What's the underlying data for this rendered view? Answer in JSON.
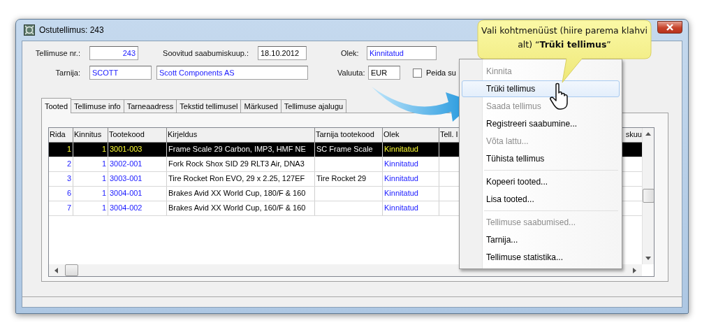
{
  "window": {
    "title": "Ostutellimus: 243"
  },
  "form": {
    "rows": [
      {
        "fields": [
          {
            "label": "Tellimuse nr.:",
            "values": [
              {
                "value": "243",
                "linked": true
              }
            ]
          },
          {
            "label": "Soovitud saabumiskuup.:",
            "values": [
              {
                "value": "18.10.2012",
                "linked": false
              }
            ]
          },
          {
            "label": "Olek:",
            "values": [
              {
                "value": "Kinnitatud",
                "linked": true
              }
            ]
          }
        ]
      },
      {
        "fields": [
          {
            "label": "Tarnija:",
            "values": [
              {
                "value": "SCOTT",
                "linked": true
              },
              {
                "value": "Scott Components AS",
                "linked": true
              }
            ]
          },
          {
            "label": "Valuuta:",
            "values": [
              {
                "value": "EUR",
                "linked": false
              }
            ]
          }
        ]
      }
    ]
  },
  "hide_option": {
    "label": "Peida su",
    "checked": false
  },
  "tabs": [
    {
      "label": "Tooted",
      "selected": true
    },
    {
      "label": "Tellimuse info",
      "selected": false
    },
    {
      "label": "Tarneaadress",
      "selected": false
    },
    {
      "label": "Tekstid tellimusel",
      "selected": false
    },
    {
      "label": "Märkused",
      "selected": false
    },
    {
      "label": "Tellimuse ajalugu",
      "selected": false
    }
  ],
  "table": {
    "columns": [
      {
        "title": "Rida",
        "kind": "number"
      },
      {
        "title": "Kinnitus",
        "kind": "number"
      },
      {
        "title": "Tootekood",
        "kind": "code"
      },
      {
        "title": "Kirjeldus",
        "kind": "text"
      },
      {
        "title": "Tarnija tootekood",
        "kind": "text"
      },
      {
        "title": "Olek",
        "kind": "code"
      },
      {
        "title": "Tell. I",
        "kind": "text"
      },
      {
        "title": "skuu",
        "kind": "text"
      }
    ],
    "rows": [
      {
        "selected": true,
        "cells": [
          "1",
          "1",
          "3001-003",
          "Frame Scale 29 Carbon, IMP3, HMF NE",
          "SC Frame Scale",
          "Kinnitatud",
          null,
          null
        ]
      },
      {
        "selected": false,
        "cells": [
          "2",
          "1",
          "3002-001",
          "Fork Rock Shox SID 29 RLT3 Air, DNA3",
          null,
          "Kinnitatud",
          null,
          null
        ]
      },
      {
        "selected": false,
        "cells": [
          "3",
          "1",
          "3003-001",
          "Tire Rocket Ron EVO, 29 x 2.25, 127EF",
          "Tire Rocket 29",
          "Kinnitatud",
          null,
          null
        ]
      },
      {
        "selected": false,
        "cells": [
          "6",
          "1",
          "3004-001",
          "Brakes Avid XX World Cup, 180/F & 160",
          null,
          "Kinnitatud",
          null,
          null
        ]
      },
      {
        "selected": false,
        "cells": [
          "7",
          "1",
          "3004-002",
          "Brakes Avid XX World Cup, 160/F & 160",
          null,
          "Kinnitatud",
          null,
          null
        ]
      }
    ]
  },
  "context_menu": {
    "items": [
      {
        "kind": "item",
        "label": "Kinnita",
        "disabled": true,
        "selected": false
      },
      {
        "kind": "item",
        "label": "Trüki tellimus",
        "disabled": false,
        "selected": true
      },
      {
        "kind": "item",
        "label": "Saada tellimus",
        "disabled": true,
        "selected": false
      },
      {
        "kind": "item",
        "label": "Registreeri saabumine...",
        "disabled": false,
        "selected": false
      },
      {
        "kind": "item",
        "label": "Võta lattu...",
        "disabled": true,
        "selected": false
      },
      {
        "kind": "item",
        "label": "Tühista tellimus",
        "disabled": false,
        "selected": false
      },
      {
        "kind": "separator"
      },
      {
        "kind": "item",
        "label": "Kopeeri tooted...",
        "disabled": false,
        "selected": false
      },
      {
        "kind": "item",
        "label": "Lisa tooted...",
        "disabled": false,
        "selected": false
      },
      {
        "kind": "separator"
      },
      {
        "kind": "item",
        "label": "Tellimuse saabumised...",
        "disabled": true,
        "selected": false
      },
      {
        "kind": "item",
        "label": "Tarnija...",
        "disabled": false,
        "selected": false
      },
      {
        "kind": "item",
        "label": "Tellimuse statistika...",
        "disabled": false,
        "selected": false
      }
    ]
  },
  "callout": {
    "text": "Vali kohtmenüüst (hiire parema klahvi alt) “**Trüki tellimus**”"
  }
}
